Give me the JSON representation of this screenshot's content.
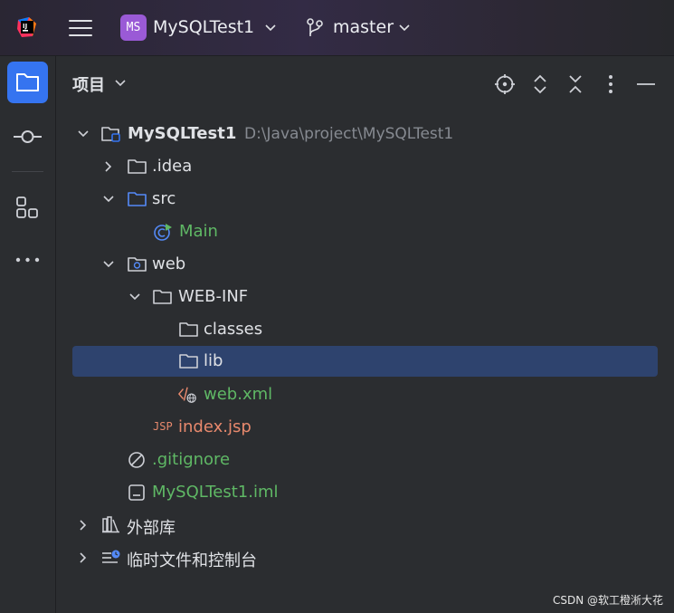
{
  "titlebar": {
    "project_badge": "MS",
    "project_name": "MySQLTest1",
    "branch": "master"
  },
  "panel": {
    "title": "项目"
  },
  "tree": {
    "root": {
      "name": "MySQLTest1",
      "path": "D:\\Java\\project\\MySQLTest1"
    },
    "idea": ".idea",
    "src": "src",
    "main": "Main",
    "web": "web",
    "webinf": "WEB-INF",
    "classes": "classes",
    "lib": "lib",
    "webxml": "web.xml",
    "jsp_badge": "JSP",
    "indexjsp": "index.jsp",
    "gitignore": ".gitignore",
    "iml": "MySQLTest1.iml",
    "external_libs": "外部库",
    "scratches": "临时文件和控制台"
  },
  "watermark": "CSDN @软工橙淅大花",
  "colors": {
    "accent": "#3574f0",
    "selection": "#2e436e",
    "green_file": "#5fb865",
    "orange_file": "#e8896d",
    "badge": "#9a5ad6"
  }
}
